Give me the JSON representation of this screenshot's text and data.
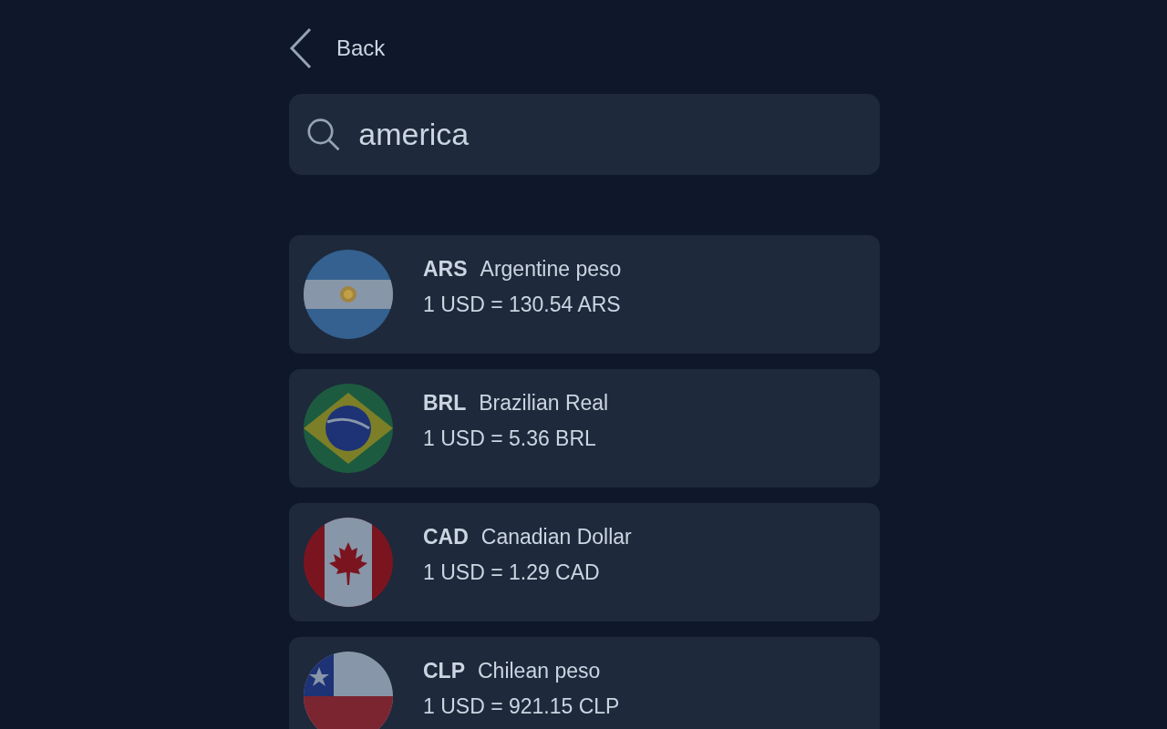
{
  "back": {
    "label": "Back"
  },
  "search": {
    "value": "america"
  },
  "currencies": [
    {
      "code": "ARS",
      "name": "Argentine peso",
      "rate": "1 USD = 130.54 ARS"
    },
    {
      "code": "BRL",
      "name": "Brazilian Real",
      "rate": "1 USD = 5.36 BRL"
    },
    {
      "code": "CAD",
      "name": "Canadian Dollar",
      "rate": "1 USD = 1.29 CAD"
    },
    {
      "code": "CLP",
      "name": "Chilean peso",
      "rate": "1 USD = 921.15 CLP"
    }
  ]
}
